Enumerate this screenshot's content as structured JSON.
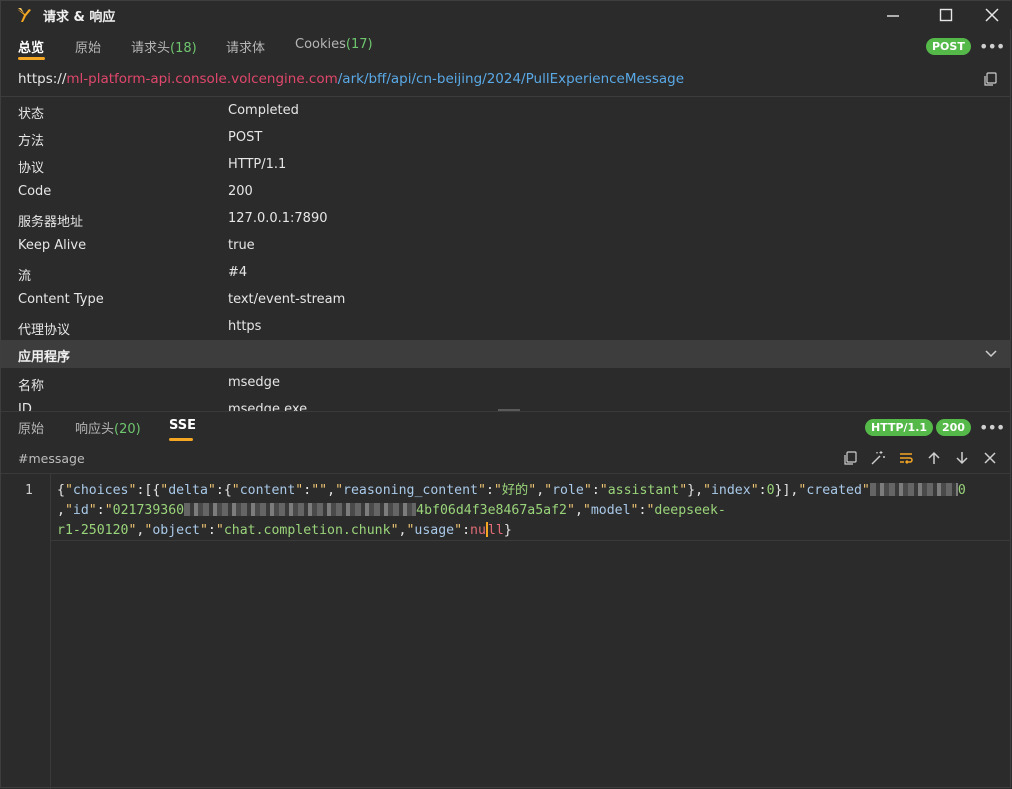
{
  "window": {
    "title": "请求 & 响应",
    "controls": [
      "minimize-icon",
      "maximize-icon",
      "close-icon"
    ]
  },
  "top_tabs": [
    {
      "label": "总览",
      "count": "",
      "active": true
    },
    {
      "label": "原始",
      "count": "",
      "active": false
    },
    {
      "label": "请求头",
      "count": "(18)",
      "active": false
    },
    {
      "label": "请求体",
      "count": "",
      "active": false
    },
    {
      "label": "Cookies",
      "count": "(17)",
      "active": false
    }
  ],
  "method_badge": "POST",
  "url": {
    "scheme": "https://",
    "host": "ml-platform-api.console.volcengine.com",
    "path": "/ark/bff/api/cn-beijing/2024/PullExperienceMessage"
  },
  "overview": [
    {
      "key": "状态",
      "value": "Completed"
    },
    {
      "key": "方法",
      "value": "POST"
    },
    {
      "key": "协议",
      "value": "HTTP/1.1"
    },
    {
      "key": "Code",
      "value": "200"
    },
    {
      "key": "服务器地址",
      "value": "127.0.0.1:7890"
    },
    {
      "key": "Keep Alive",
      "value": "true"
    },
    {
      "key": "流",
      "value": "#4"
    },
    {
      "key": "Content Type",
      "value": "text/event-stream"
    },
    {
      "key": "代理协议",
      "value": "https"
    }
  ],
  "app_section": {
    "title": "应用程序",
    "rows": [
      {
        "key": "名称",
        "value": "msedge"
      },
      {
        "key": "ID",
        "value": "msedge.exe"
      }
    ]
  },
  "bottom_tabs": [
    {
      "label": "原始",
      "count": "",
      "active": false
    },
    {
      "label": "响应头",
      "count": "(20)",
      "active": false
    },
    {
      "label": "SSE",
      "count": "",
      "active": true
    }
  ],
  "bottom_badges": {
    "protocol": "HTTP/1.1",
    "status": "200"
  },
  "event_name": "#message",
  "toolbar_icons": [
    "copy-icon",
    "magic-wand-icon",
    "wrap-icon",
    "arrow-up-icon",
    "arrow-down-icon",
    "close-icon"
  ],
  "code": {
    "line_number": "1",
    "choices_key": "choices",
    "delta_key": "delta",
    "content_key": "content",
    "content_val": "",
    "reasoning_key": "reasoning_content",
    "reasoning_val": "好的",
    "role_key": "role",
    "role_val": "assistant",
    "index_key": "index",
    "index_val": "0",
    "created_key": "created",
    "created_tail": "0",
    "id_key": "id",
    "id_head": "021739360",
    "id_tail": "4bf06d4f3e8467a5af2",
    "model_key": "model",
    "model_val_1": "deepseek-",
    "model_val_2": "r1-250120",
    "object_key": "object",
    "object_val": "chat.completion.chunk",
    "usage_key": "usage",
    "usage_val_a": "nu",
    "usage_val_b": "ll"
  }
}
